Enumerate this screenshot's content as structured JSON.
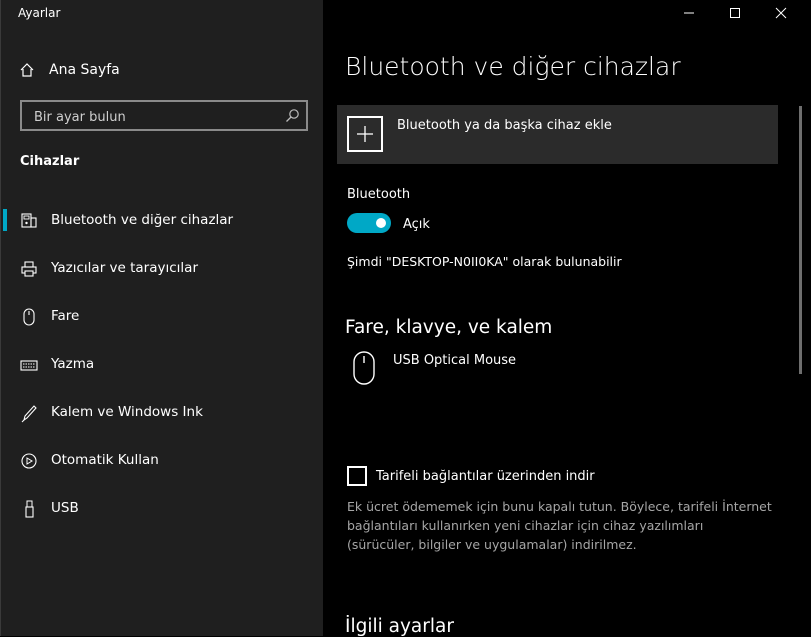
{
  "window": {
    "title": "Ayarlar"
  },
  "sidebar": {
    "home_label": "Ana Sayfa",
    "search_placeholder": "Bir ayar bulun",
    "section_header": "Cihazlar",
    "items": [
      {
        "label": "Bluetooth ve diğer cihazlar",
        "icon": "bluetooth-devices-icon",
        "active": true
      },
      {
        "label": "Yazıcılar ve tarayıcılar",
        "icon": "printer-icon"
      },
      {
        "label": "Fare",
        "icon": "mouse-icon"
      },
      {
        "label": "Yazma",
        "icon": "keyboard-icon"
      },
      {
        "label": "Kalem ve Windows Ink",
        "icon": "pen-icon"
      },
      {
        "label": "Otomatik Kullan",
        "icon": "autoplay-icon"
      },
      {
        "label": "USB",
        "icon": "usb-icon"
      }
    ]
  },
  "main": {
    "title": "Bluetooth ve diğer cihazlar",
    "add_device_label": "Bluetooth ya da başka cihaz ekle",
    "bluetooth_label": "Bluetooth",
    "bluetooth_state": "Açık",
    "discoverable_text": "Şimdi \"DESKTOP-N0II0KA\" olarak bulunabilir",
    "mouse_section_header": "Fare, klavye, ve kalem",
    "devices": [
      {
        "name": "USB Optical Mouse",
        "icon": "mouse-icon"
      }
    ],
    "metered_checkbox_label": "Tarifeli bağlantılar üzerinden indir",
    "metered_checked": false,
    "metered_description": "Ek ücret ödememek için bunu kapalı tutun. Böylece, tarifeli İnternet bağlantıları kullanırken yeni cihazlar için cihaz yazılımları (sürücüler, bilgiler ve uygulamalar) indirilmez.",
    "related_settings_header": "İlgili ayarlar"
  },
  "colors": {
    "accent": "#00a8c6",
    "sidebar_bg": "#1f1f1f",
    "main_bg": "#000000",
    "card_bg": "#2b2b2b"
  }
}
